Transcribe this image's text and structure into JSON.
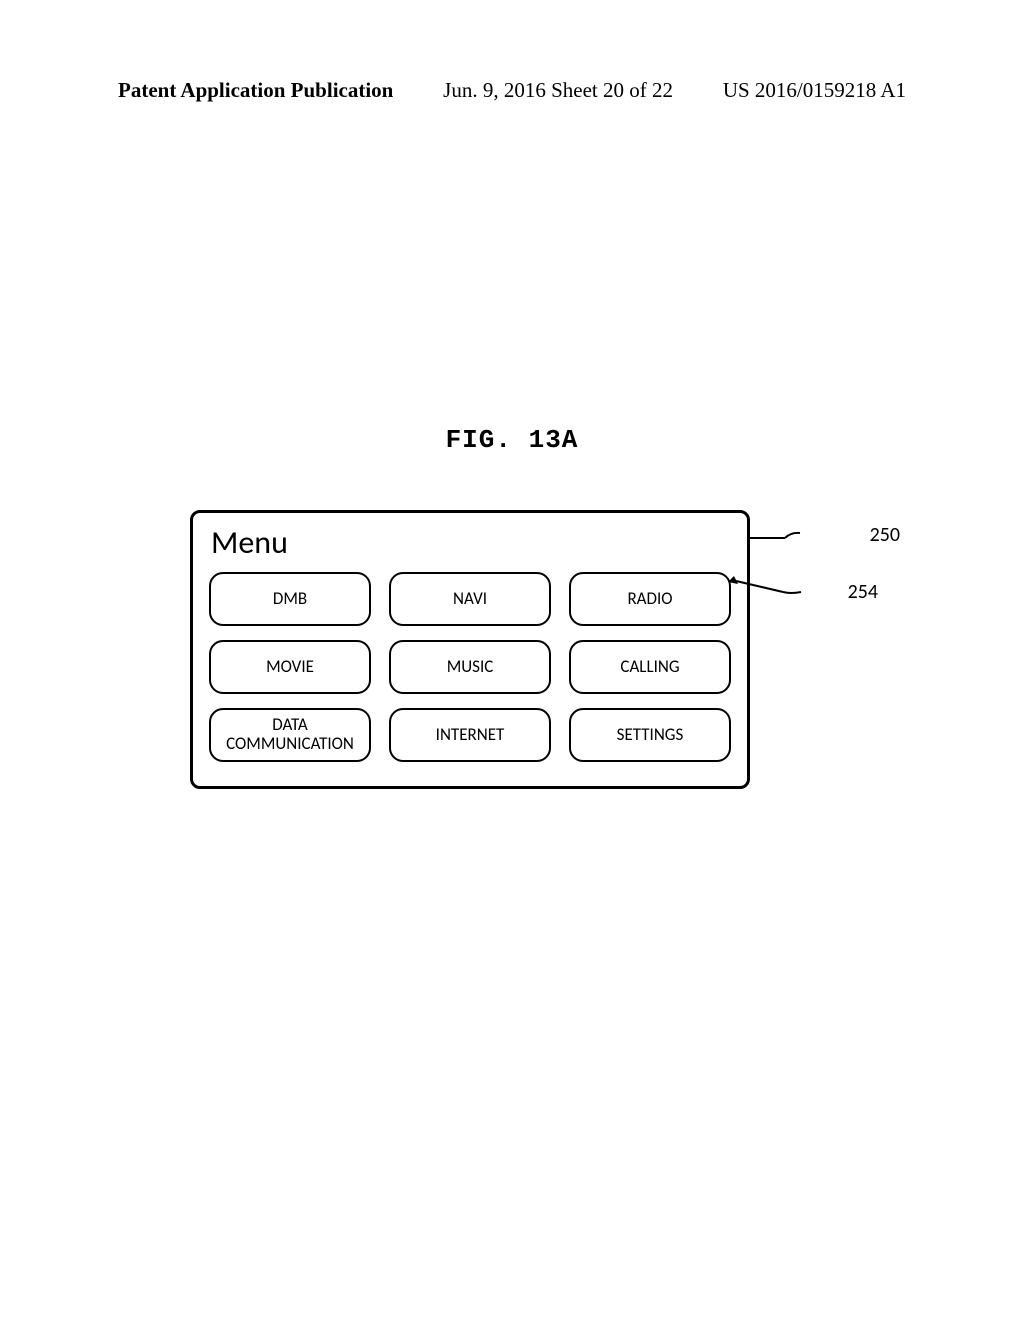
{
  "header": {
    "left": "Patent Application Publication",
    "center": "Jun. 9, 2016   Sheet 20 of 22",
    "right": "US 2016/0159218 A1"
  },
  "figure_label": "FIG. 13A",
  "panel": {
    "title": "Menu",
    "items": [
      "DMB",
      "NAVI",
      "RADIO",
      "MOVIE",
      "MUSIC",
      "CALLING",
      "DATA\nCOMMUNICATION",
      "INTERNET",
      "SETTINGS"
    ]
  },
  "callouts": {
    "panel_ref": "250",
    "item_ref": "254"
  }
}
